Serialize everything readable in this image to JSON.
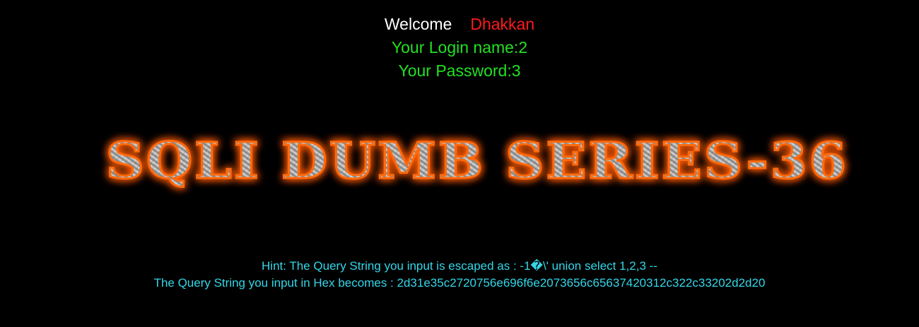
{
  "greeting": {
    "welcome_label": "Welcome",
    "username": "Dhakkan"
  },
  "credentials": {
    "login_text": "Your Login name:2",
    "password_text": "Your Password:3"
  },
  "banner": {
    "title": "SQLI DUMB SERIES-36"
  },
  "hint": {
    "escaped_text": "Hint: The Query String you input is escaped as : -1�\\' union select 1,2,3 --",
    "hex_text": "The Query String you input in Hex becomes : 2d31e35c2720756e696f6e2073656c65637420312c322c33202d2d20"
  },
  "colors": {
    "background": "#000000",
    "welcome": "#ffffff",
    "username": "#ff1a1a",
    "credentials": "#22e022",
    "hint": "#33d6e8",
    "banner_glow": "#ff5a00"
  }
}
